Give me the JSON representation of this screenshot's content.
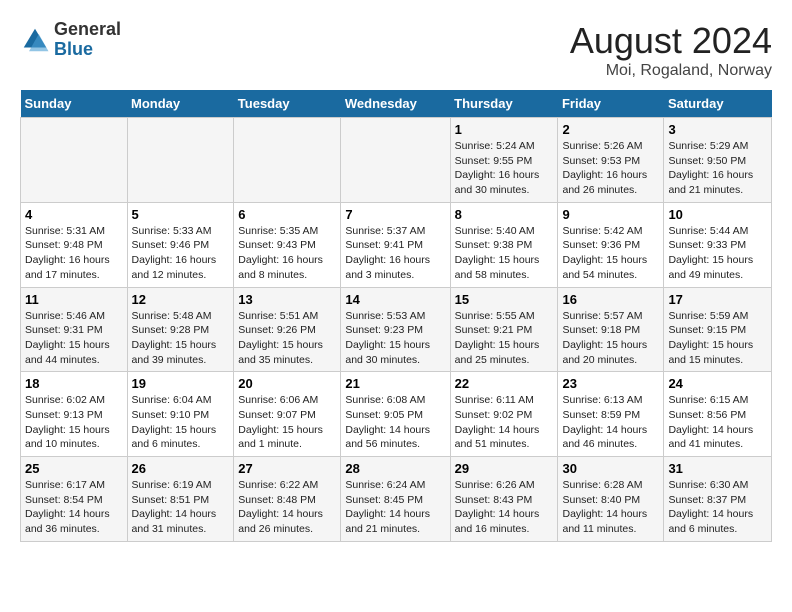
{
  "logo": {
    "general": "General",
    "blue": "Blue"
  },
  "title": "August 2024",
  "subtitle": "Moi, Rogaland, Norway",
  "days_of_week": [
    "Sunday",
    "Monday",
    "Tuesday",
    "Wednesday",
    "Thursday",
    "Friday",
    "Saturday"
  ],
  "weeks": [
    [
      {
        "day": "",
        "info": ""
      },
      {
        "day": "",
        "info": ""
      },
      {
        "day": "",
        "info": ""
      },
      {
        "day": "",
        "info": ""
      },
      {
        "day": "1",
        "info": "Sunrise: 5:24 AM\nSunset: 9:55 PM\nDaylight: 16 hours and 30 minutes."
      },
      {
        "day": "2",
        "info": "Sunrise: 5:26 AM\nSunset: 9:53 PM\nDaylight: 16 hours and 26 minutes."
      },
      {
        "day": "3",
        "info": "Sunrise: 5:29 AM\nSunset: 9:50 PM\nDaylight: 16 hours and 21 minutes."
      }
    ],
    [
      {
        "day": "4",
        "info": "Sunrise: 5:31 AM\nSunset: 9:48 PM\nDaylight: 16 hours and 17 minutes."
      },
      {
        "day": "5",
        "info": "Sunrise: 5:33 AM\nSunset: 9:46 PM\nDaylight: 16 hours and 12 minutes."
      },
      {
        "day": "6",
        "info": "Sunrise: 5:35 AM\nSunset: 9:43 PM\nDaylight: 16 hours and 8 minutes."
      },
      {
        "day": "7",
        "info": "Sunrise: 5:37 AM\nSunset: 9:41 PM\nDaylight: 16 hours and 3 minutes."
      },
      {
        "day": "8",
        "info": "Sunrise: 5:40 AM\nSunset: 9:38 PM\nDaylight: 15 hours and 58 minutes."
      },
      {
        "day": "9",
        "info": "Sunrise: 5:42 AM\nSunset: 9:36 PM\nDaylight: 15 hours and 54 minutes."
      },
      {
        "day": "10",
        "info": "Sunrise: 5:44 AM\nSunset: 9:33 PM\nDaylight: 15 hours and 49 minutes."
      }
    ],
    [
      {
        "day": "11",
        "info": "Sunrise: 5:46 AM\nSunset: 9:31 PM\nDaylight: 15 hours and 44 minutes."
      },
      {
        "day": "12",
        "info": "Sunrise: 5:48 AM\nSunset: 9:28 PM\nDaylight: 15 hours and 39 minutes."
      },
      {
        "day": "13",
        "info": "Sunrise: 5:51 AM\nSunset: 9:26 PM\nDaylight: 15 hours and 35 minutes."
      },
      {
        "day": "14",
        "info": "Sunrise: 5:53 AM\nSunset: 9:23 PM\nDaylight: 15 hours and 30 minutes."
      },
      {
        "day": "15",
        "info": "Sunrise: 5:55 AM\nSunset: 9:21 PM\nDaylight: 15 hours and 25 minutes."
      },
      {
        "day": "16",
        "info": "Sunrise: 5:57 AM\nSunset: 9:18 PM\nDaylight: 15 hours and 20 minutes."
      },
      {
        "day": "17",
        "info": "Sunrise: 5:59 AM\nSunset: 9:15 PM\nDaylight: 15 hours and 15 minutes."
      }
    ],
    [
      {
        "day": "18",
        "info": "Sunrise: 6:02 AM\nSunset: 9:13 PM\nDaylight: 15 hours and 10 minutes."
      },
      {
        "day": "19",
        "info": "Sunrise: 6:04 AM\nSunset: 9:10 PM\nDaylight: 15 hours and 6 minutes."
      },
      {
        "day": "20",
        "info": "Sunrise: 6:06 AM\nSunset: 9:07 PM\nDaylight: 15 hours and 1 minute."
      },
      {
        "day": "21",
        "info": "Sunrise: 6:08 AM\nSunset: 9:05 PM\nDaylight: 14 hours and 56 minutes."
      },
      {
        "day": "22",
        "info": "Sunrise: 6:11 AM\nSunset: 9:02 PM\nDaylight: 14 hours and 51 minutes."
      },
      {
        "day": "23",
        "info": "Sunrise: 6:13 AM\nSunset: 8:59 PM\nDaylight: 14 hours and 46 minutes."
      },
      {
        "day": "24",
        "info": "Sunrise: 6:15 AM\nSunset: 8:56 PM\nDaylight: 14 hours and 41 minutes."
      }
    ],
    [
      {
        "day": "25",
        "info": "Sunrise: 6:17 AM\nSunset: 8:54 PM\nDaylight: 14 hours and 36 minutes."
      },
      {
        "day": "26",
        "info": "Sunrise: 6:19 AM\nSunset: 8:51 PM\nDaylight: 14 hours and 31 minutes."
      },
      {
        "day": "27",
        "info": "Sunrise: 6:22 AM\nSunset: 8:48 PM\nDaylight: 14 hours and 26 minutes."
      },
      {
        "day": "28",
        "info": "Sunrise: 6:24 AM\nSunset: 8:45 PM\nDaylight: 14 hours and 21 minutes."
      },
      {
        "day": "29",
        "info": "Sunrise: 6:26 AM\nSunset: 8:43 PM\nDaylight: 14 hours and 16 minutes."
      },
      {
        "day": "30",
        "info": "Sunrise: 6:28 AM\nSunset: 8:40 PM\nDaylight: 14 hours and 11 minutes."
      },
      {
        "day": "31",
        "info": "Sunrise: 6:30 AM\nSunset: 8:37 PM\nDaylight: 14 hours and 6 minutes."
      }
    ]
  ]
}
